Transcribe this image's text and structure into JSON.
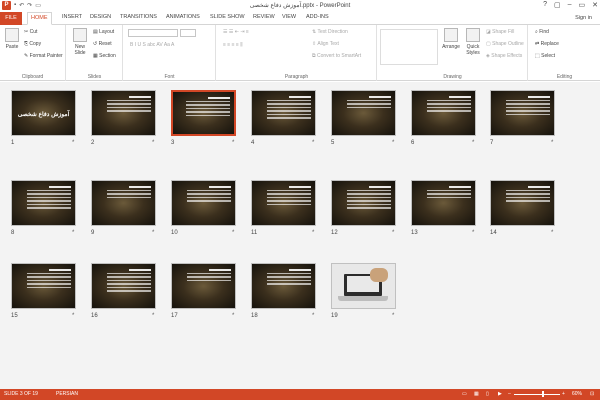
{
  "window": {
    "title": "آموزش دفاع شخصی.pptx - PowerPoint",
    "icon_name": "powerpoint-icon",
    "controls": [
      "?",
      "▢",
      "–",
      "▭",
      "✕"
    ]
  },
  "tabs": {
    "file": "FILE",
    "items": [
      "HOME",
      "INSERT",
      "DESIGN",
      "TRANSITIONS",
      "ANIMATIONS",
      "SLIDE SHOW",
      "REVIEW",
      "VIEW",
      "ADD-INS"
    ],
    "active": "HOME",
    "signin": "Sign in"
  },
  "ribbon": {
    "clipboard": {
      "label": "Clipboard",
      "paste": "Paste",
      "cut": "Cut",
      "copy": "Copy",
      "format_painter": "Format Painter"
    },
    "slides": {
      "label": "Slides",
      "new_slide": "New Slide",
      "layout": "Layout",
      "reset": "Reset",
      "section": "Section"
    },
    "font": {
      "label": "Font"
    },
    "paragraph": {
      "label": "Paragraph",
      "text_direction": "Text Direction",
      "align_text": "Align Text",
      "convert": "Convert to SmartArt"
    },
    "drawing": {
      "label": "Drawing",
      "arrange": "Arrange",
      "quick_styles": "Quick Styles",
      "shape_fill": "Shape Fill",
      "shape_outline": "Shape Outline",
      "shape_effects": "Shape Effects"
    },
    "editing": {
      "label": "Editing",
      "find": "Find",
      "replace": "Replace",
      "select": "Select"
    }
  },
  "slides": [
    {
      "n": "1",
      "title": "آموزش دفاع شخصی"
    },
    {
      "n": "2"
    },
    {
      "n": "3"
    },
    {
      "n": "4"
    },
    {
      "n": "5"
    },
    {
      "n": "6"
    },
    {
      "n": "7"
    },
    {
      "n": "8"
    },
    {
      "n": "9"
    },
    {
      "n": "10"
    },
    {
      "n": "11"
    },
    {
      "n": "12"
    },
    {
      "n": "13"
    },
    {
      "n": "14"
    },
    {
      "n": "15"
    },
    {
      "n": "16"
    },
    {
      "n": "17"
    },
    {
      "n": "18"
    },
    {
      "n": "19"
    }
  ],
  "selected_slide": "3",
  "star": "*",
  "status": {
    "slide_info": "SLIDE 3 OF 19",
    "language": "PERSIAN",
    "zoom": "60%",
    "zoom_fraction": 0.6
  },
  "colors": {
    "accent": "#d24726"
  }
}
